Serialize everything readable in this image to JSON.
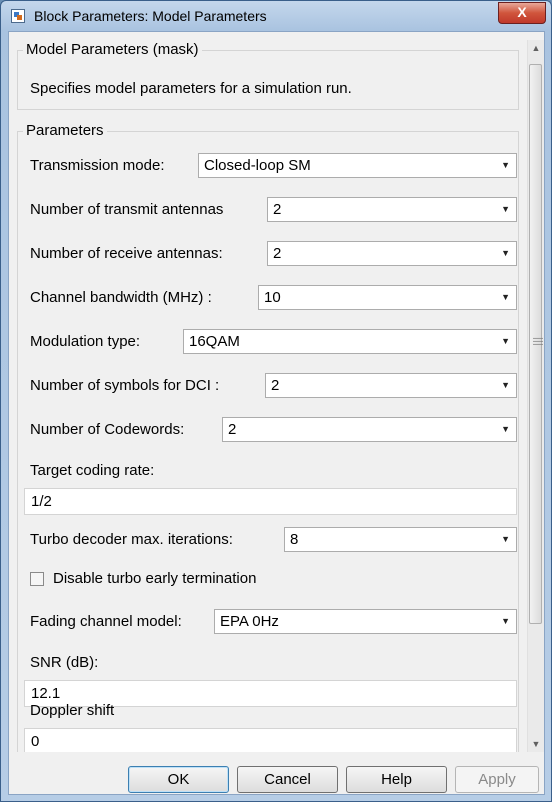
{
  "window": {
    "title": "Block Parameters: Model Parameters",
    "close_glyph": "X"
  },
  "mask": {
    "title": "Model Parameters (mask)",
    "description": "Specifies model parameters for a simulation run."
  },
  "parameters": {
    "group_title": "Parameters",
    "transmission_mode": {
      "label": "Transmission mode:",
      "value": "Closed-loop SM"
    },
    "num_tx_antennas": {
      "label": "Number of transmit antennas",
      "value": "2"
    },
    "num_rx_antennas": {
      "label": "Number of receive antennas:",
      "value": "2"
    },
    "channel_bandwidth": {
      "label": "Channel bandwidth (MHz) :",
      "value": "10"
    },
    "modulation_type": {
      "label": "Modulation type:",
      "value": "16QAM"
    },
    "dci_symbols": {
      "label": "Number of symbols for DCI :",
      "value": "2"
    },
    "num_codewords": {
      "label": "Number of Codewords:",
      "value": "2"
    },
    "target_coding_rate": {
      "label": "Target coding rate:",
      "value": "1/2"
    },
    "turbo_iterations": {
      "label": "Turbo decoder max. iterations:",
      "value": "8"
    },
    "disable_early_termination": {
      "label": "Disable turbo early termination",
      "checked": false
    },
    "fading_channel": {
      "label": "Fading channel model:",
      "value": "EPA 0Hz"
    },
    "snr": {
      "label": "SNR (dB):",
      "value": "12.1"
    },
    "doppler_shift": {
      "label": "Doppler shift",
      "value": "0"
    }
  },
  "buttons": {
    "ok": "OK",
    "cancel": "Cancel",
    "help": "Help",
    "apply": "Apply"
  },
  "icons": {
    "dropdown": "chevron-down-icon",
    "scroll_up": "scroll-up-arrow-icon",
    "scroll_down": "scroll-down-arrow-icon",
    "app": "simulink-block-icon"
  }
}
